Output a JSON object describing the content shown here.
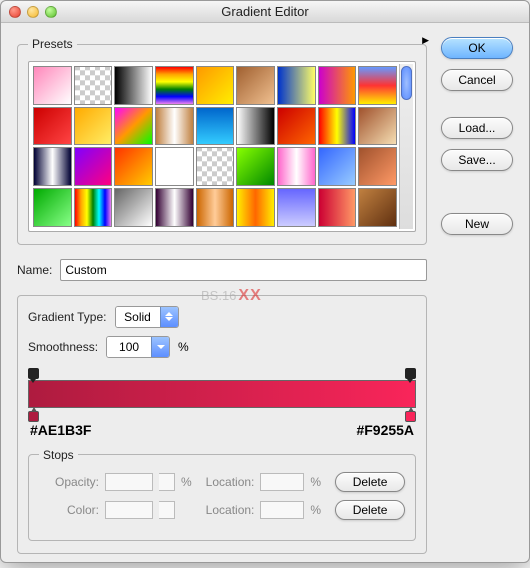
{
  "window": {
    "title": "Gradient Editor"
  },
  "presets": {
    "legend": "Presets",
    "swatches": [
      "linear-gradient(135deg,#f8b,#fff)",
      "repeating-conic-gradient(#ccc 0 25%,#fff 0 50%) 0/10px 10px",
      "linear-gradient(90deg,#000,#fff)",
      "linear-gradient(180deg,red,orange,yellow,green,blue,violet)",
      "linear-gradient(135deg,#ff9900,#ffee00)",
      "linear-gradient(135deg,#a06030,#f0c090)",
      "linear-gradient(90deg,#0033cc,#ffff66)",
      "linear-gradient(90deg,#cc00cc,#ff9900)",
      "linear-gradient(180deg,#6699ff,#ff3333,#ffee00)",
      "linear-gradient(135deg,#c00,#f44)",
      "linear-gradient(135deg,#fa0,#fe6)",
      "linear-gradient(135deg,#ff00ff,#ff9900,#00ff00)",
      "linear-gradient(90deg,#c08040,#fff,#c08040)",
      "linear-gradient(180deg,#0066cc,#33ccff)",
      "linear-gradient(90deg,#ffffff,#000000)",
      "linear-gradient(135deg,#cc0000,#ff6600)",
      "linear-gradient(90deg,red,yellow,#00f)",
      "linear-gradient(135deg,#a0522d,#f5deb3)",
      "linear-gradient(90deg,#003,#fff,#003)",
      "linear-gradient(135deg,#8000ff,#ff0080)",
      "linear-gradient(135deg,#ff3300,#ffcc00)",
      "linear-gradient(90deg,#fff,#fff)",
      "repeating-conic-gradient(#ccc 0 25%,#fff 0 50%) 0/10px 10px",
      "linear-gradient(135deg,#88ff00,#008800)",
      "linear-gradient(90deg,#ff66cc,#fff,#ff66cc)",
      "linear-gradient(135deg,#3366ff,#99ccff)",
      "linear-gradient(135deg,#a0522d,#ff9966)",
      "linear-gradient(135deg,#0a0,#8f8)",
      "linear-gradient(90deg,red,orange,yellow,green,cyan,blue,violet)",
      "linear-gradient(135deg,#666,#fff)",
      "linear-gradient(90deg,#330033,#fff,#330033)",
      "linear-gradient(90deg,#cc6600,#ffcc99,#cc6600)",
      "linear-gradient(90deg,#ffee00,#ff6600,#ffee00)",
      "linear-gradient(180deg,#6666ff,#ccccff)",
      "linear-gradient(90deg,#cc0033,#ff9966)",
      "linear-gradient(135deg,#c08040,#603010)"
    ]
  },
  "buttons": {
    "ok": "OK",
    "cancel": "Cancel",
    "load": "Load...",
    "save": "Save...",
    "new": "New",
    "delete": "Delete"
  },
  "name": {
    "label": "Name:",
    "value": "Custom"
  },
  "gradient": {
    "legend_type": "Gradient Type:",
    "type_value": "Solid",
    "smoothness_label": "Smoothness:",
    "smoothness_value": "100",
    "pct": "%",
    "hex_left": "#AE1B3F",
    "hex_right": "#F9255A"
  },
  "stops": {
    "legend": "Stops",
    "opacity_label": "Opacity:",
    "color_label": "Color:",
    "location_label": "Location:"
  },
  "watermark": {
    "text": "BS.16",
    "xx": "XX"
  }
}
